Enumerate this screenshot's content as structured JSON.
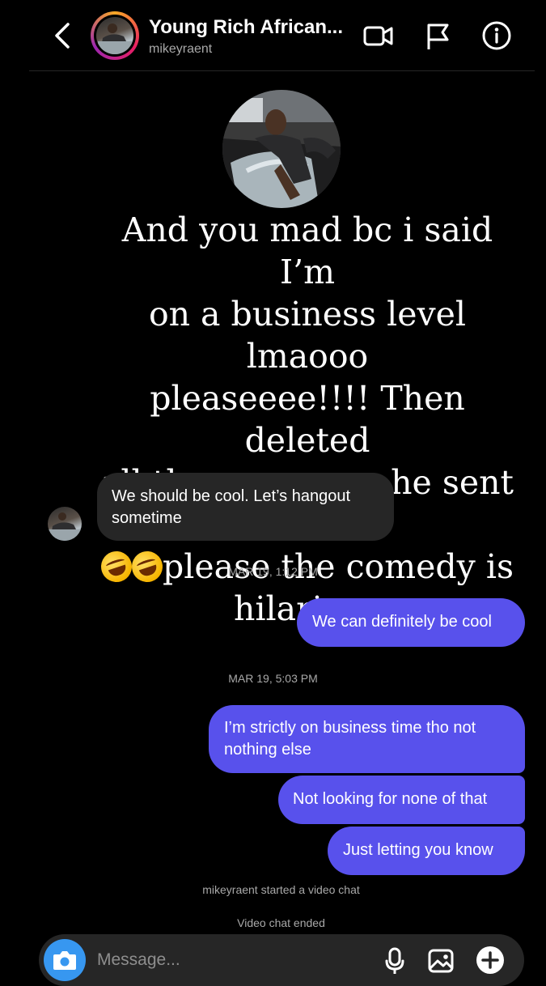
{
  "header": {
    "title": "Young Rich African...",
    "username": "mikeyraent"
  },
  "story_text": {
    "line1": "And you mad bc i said I’m",
    "line2": "on a business level lmaooo",
    "line3": "pleaseeee!!!! Then deleted",
    "line4": "all the messages he sent",
    "line5_tail": "please the comedy is",
    "line6": "hilarious"
  },
  "messages": {
    "in1_line1": "We should be cool. Let’s hangout",
    "in1_line2": "sometime",
    "ts1": "MAR 19, 1:12 PM",
    "out1": "We can definitely be cool",
    "ts2": "MAR 19, 5:03 PM",
    "out2_line1": "I’m strictly on business time tho not",
    "out2_line2": "nothing else",
    "out3": "Not looking for none of that",
    "out4": "Just letting you know",
    "sys1": "mikeyraent started a video chat",
    "sys2": "Video chat ended"
  },
  "composer": {
    "placeholder": "Message..."
  },
  "icons": {
    "back": "chevron-left-icon",
    "video": "video-camera-icon",
    "flag": "flag-icon",
    "info": "info-icon",
    "camera": "camera-icon",
    "mic": "microphone-icon",
    "gallery": "image-icon",
    "add": "plus-icon"
  },
  "colors": {
    "background": "#000000",
    "incoming_bubble": "#262626",
    "outgoing_bubble": "#5851ec",
    "camera_button": "#3797f0",
    "secondary_text": "#a8a8a8"
  }
}
